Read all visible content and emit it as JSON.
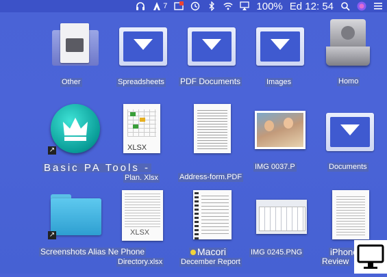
{
  "menubar": {
    "headphones_icon": "headphones-icon",
    "badge_number": "7",
    "battery_text": "100%",
    "clock_text": "Ed 12: 54",
    "items": [
      "headphones-icon",
      "adobe-icon",
      "notification-icon",
      "time-machine-icon",
      "bluetooth-icon",
      "wifi-icon",
      "airplay-icon",
      "battery-icon",
      "search-icon",
      "siri-icon",
      "menu-list-icon"
    ]
  },
  "desktop": {
    "items": [
      {
        "label": "Other",
        "icon": "drive-icon"
      },
      {
        "label": "Spreadsheets",
        "icon": "folder-icon"
      },
      {
        "label": "PDF Documents",
        "icon": "folder-icon"
      },
      {
        "label": "Images",
        "icon": "folder-icon"
      },
      {
        "label": "Homo",
        "icon": "hard-drive-icon"
      },
      {
        "label": "Basic PA Tools -",
        "icon": "crown-app-icon"
      },
      {
        "label": "Plan. Xlsx",
        "icon": "xlsx-file-icon"
      },
      {
        "label": "Address-form.PDF",
        "icon": "pdf-file-icon"
      },
      {
        "label": "IMG 0037.P",
        "icon": "photo-file-icon"
      },
      {
        "label": "Documents",
        "icon": "folder-icon"
      },
      {
        "label": "Screenshots Alias Ne Phone",
        "icon": "cyan-folder-icon"
      },
      {
        "label": "Directory.xlsx",
        "icon": "xlsx-file-icon"
      },
      {
        "label": "Macori",
        "icon": "notebook-icon"
      },
      {
        "label": "December Report",
        "icon": "notebook-label"
      },
      {
        "label": "IMG 0245.PNG",
        "icon": "keyboard-screenshot-icon"
      },
      {
        "label": "iPhone",
        "icon": "document-icon"
      },
      {
        "label": "Review",
        "icon": "document-icon"
      }
    ],
    "xlsx_tag": "XLSX"
  },
  "colors": {
    "desktop_bg": "#4a63d6",
    "menubar_bg": "#3a4fc0",
    "label_bg": "#5a69a0"
  }
}
